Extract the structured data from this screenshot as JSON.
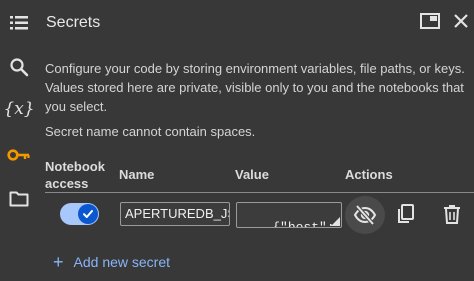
{
  "sidebar": {
    "items": [
      {
        "icon": "table-of-contents-icon"
      },
      {
        "icon": "search-icon"
      },
      {
        "icon": "variables-icon",
        "label": "{x}"
      },
      {
        "icon": "key-icon",
        "accent": "#f29900"
      },
      {
        "icon": "folder-icon"
      }
    ]
  },
  "panel": {
    "title": "Secrets",
    "description": "Configure your code by storing environment variables, file paths, or keys. Values stored here are private, visible only to you and the notebooks that you select.",
    "note": "Secret name cannot contain spaces.",
    "columns": {
      "access_line1": "Notebook",
      "access_line2": "access",
      "name": "Name",
      "value": "Value",
      "actions": "Actions"
    },
    "secret": {
      "access_enabled": true,
      "name": "APERTUREDB_JSON",
      "value": "{\"host\":\n\"localhost"
    },
    "add_label": "Add new secret"
  },
  "colors": {
    "background": "#383838",
    "accent_blue": "#8ab4f8",
    "toggle_track": "#a8c7fa",
    "toggle_knob": "#0b57d0",
    "key_orange": "#f29900"
  }
}
